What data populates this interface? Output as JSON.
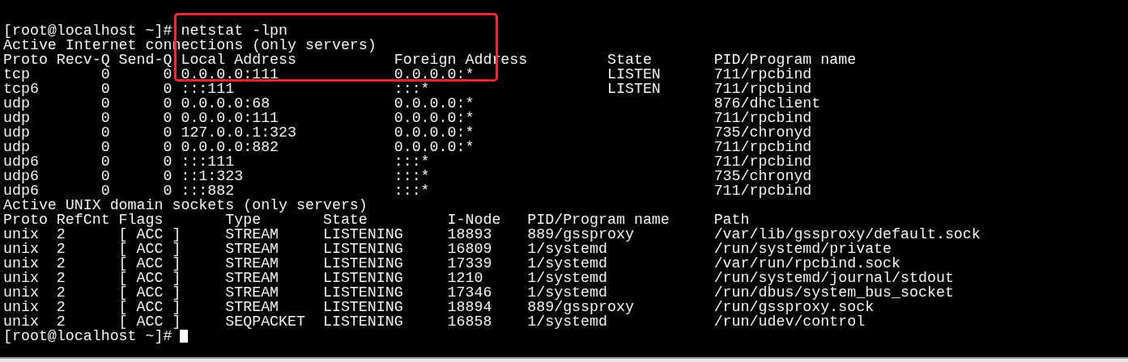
{
  "terminal": {
    "lines": [
      "[root@localhost ~]# netstat -lpn",
      "Active Internet connections (only servers)",
      "Proto Recv-Q Send-Q Local Address           Foreign Address         State       PID/Program name",
      "tcp        0      0 0.0.0.0:111             0.0.0.0:*               LISTEN      711/rpcbind",
      "tcp6       0      0 :::111                  :::*                    LISTEN      711/rpcbind",
      "udp        0      0 0.0.0.0:68              0.0.0.0:*                           876/dhclient",
      "udp        0      0 0.0.0.0:111             0.0.0.0:*                           711/rpcbind",
      "udp        0      0 127.0.0.1:323           0.0.0.0:*                           735/chronyd",
      "udp        0      0 0.0.0.0:882             0.0.0.0:*                           711/rpcbind",
      "udp6       0      0 :::111                  :::*                                711/rpcbind",
      "udp6       0      0 ::1:323                 :::*                                735/chronyd",
      "udp6       0      0 :::882                  :::*                                711/rpcbind",
      "Active UNIX domain sockets (only servers)",
      "Proto RefCnt Flags       Type       State         I-Node   PID/Program name     Path",
      "unix  2      [ ACC ]     STREAM     LISTENING     18893    889/gssproxy         /var/lib/gssproxy/default.sock",
      "unix  2      [ ACC ]     STREAM     LISTENING     16809    1/systemd            /run/systemd/private",
      "unix  2      [ ACC ]     STREAM     LISTENING     17339    1/systemd            /var/run/rpcbind.sock",
      "unix  2      [ ACC ]     STREAM     LISTENING     1210     1/systemd            /run/systemd/journal/stdout",
      "unix  2      [ ACC ]     STREAM     LISTENING     17346    1/systemd            /run/dbus/system_bus_socket",
      "unix  2      [ ACC ]     STREAM     LISTENING     18894    889/gssproxy         /run/gssproxy.sock",
      "unix  2      [ ACC ]     SEQPACKET  LISTENING     16858    1/systemd            /run/udev/control"
    ],
    "prompt": "[root@localhost ~]#",
    "cursor_visible": true
  },
  "annotations": [
    {
      "kind": "box",
      "color": "#ee2a2a"
    }
  ]
}
